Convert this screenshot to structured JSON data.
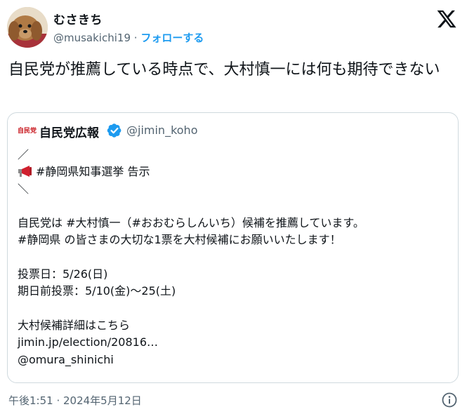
{
  "author": {
    "display_name": "むさきち",
    "handle": "@musakichi19",
    "separator": "·",
    "follow_label": "フォローする"
  },
  "tweet": {
    "text": "自民党が推薦している時点で、大村慎一には何も期待できない",
    "timestamp": "午後1:51 · 2024年5月12日"
  },
  "quote": {
    "logo_text": "自民党",
    "display_name": "自民党広報",
    "handle": "@jimin_koho",
    "lines": [
      "／",
      "#静岡県知事選挙 告示",
      "＼",
      "",
      "自民党は #大村慎一（#おおむらしんいち）候補を推薦しています。",
      "#静岡県 の皆さまの大切な1票を大村候補にお願いいたします！",
      "",
      "投票日：5/26(日)",
      "期日前投票：5/10(金)〜25(土)",
      "",
      "大村候補詳細はこちら",
      "jimin.jp/election/20816…",
      "@omura_shinichi"
    ]
  },
  "colors": {
    "link_blue": "#1d9bf0",
    "secondary_text": "#536471",
    "border": "#cfd9de",
    "megaphone_red": "#d0202e"
  },
  "icons": [
    "x-logo-icon",
    "verified-badge-icon",
    "megaphone-icon",
    "info-icon"
  ]
}
